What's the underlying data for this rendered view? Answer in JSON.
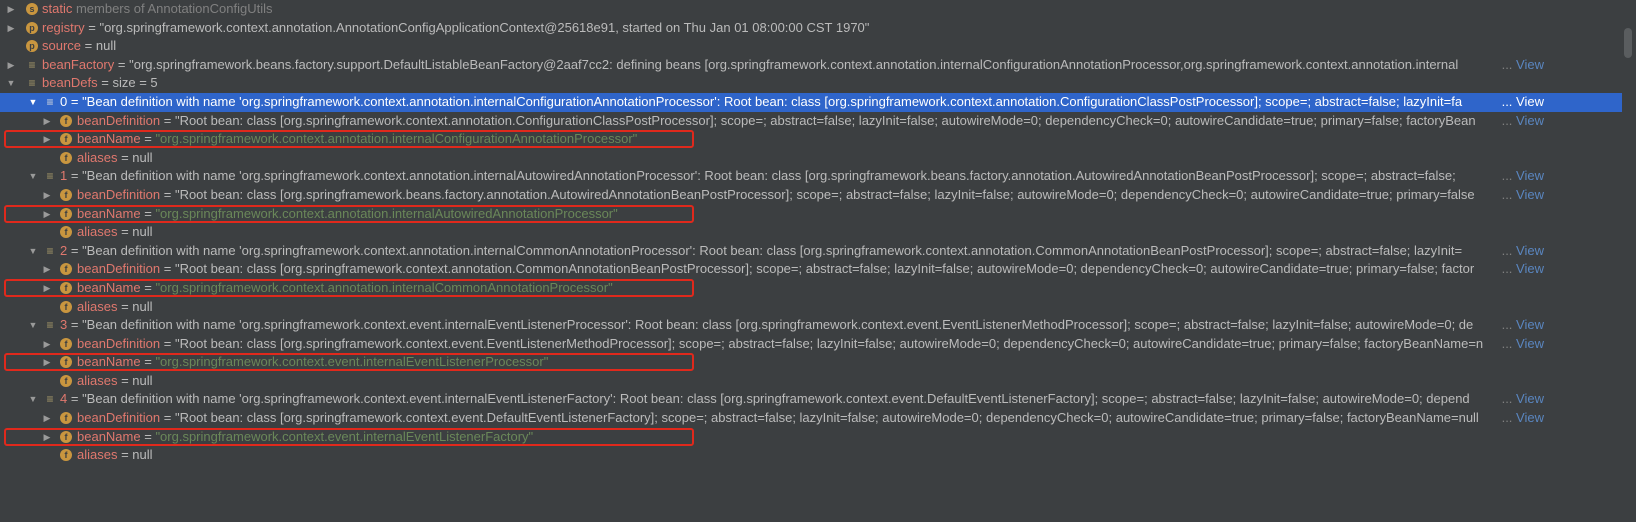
{
  "colors": {
    "background": "#3c3f41",
    "selection": "#2f65ca",
    "field_name": "#e0786e",
    "string_value": "#6a8759",
    "highlight_box": "#e0291c",
    "link": "#5a86c0"
  },
  "view_label": "View",
  "ellipsis": "...",
  "rows": [
    {
      "name": "static",
      "rest": " members of AnnotationConfigUtils",
      "icon": "s"
    },
    {
      "name": "registry",
      "eq": " = ",
      "value": "\"org.springframework.context.annotation.AnnotationConfigApplicationContext@25618e91, started on Thu Jan 01 08:00:00 CST 1970\"",
      "icon": "p"
    },
    {
      "name": "source",
      "eq": " = ",
      "value": "null",
      "icon": "p"
    },
    {
      "name": "beanFactory",
      "eq": " = ",
      "value": "\"org.springframework.beans.factory.support.DefaultListableBeanFactory@2aaf7cc2: defining beans [org.springframework.context.annotation.internalConfigurationAnnotationProcessor,org.springframework.context.annotation.internal",
      "icon": "list"
    },
    {
      "name": "beanDefs",
      "eq": " = ",
      "value": " size = 5",
      "icon": "list"
    },
    {
      "name": "0",
      "eq": " = ",
      "value": "\"Bean definition with name 'org.springframework.context.annotation.internalConfigurationAnnotationProcessor': Root bean: class [org.springframework.context.annotation.ConfigurationClassPostProcessor]; scope=; abstract=false; lazyInit=fa",
      "icon": "list"
    },
    {
      "name": "beanDefinition",
      "eq": " = ",
      "value": "\"Root bean: class [org.springframework.context.annotation.ConfigurationClassPostProcessor]; scope=; abstract=false; lazyInit=false; autowireMode=0; dependencyCheck=0; autowireCandidate=true; primary=false; factoryBean",
      "icon": "f"
    },
    {
      "name": "beanName",
      "eq": " = ",
      "value": "\"org.springframework.context.annotation.internalConfigurationAnnotationProcessor\"",
      "icon": "f"
    },
    {
      "name": "aliases",
      "eq": " = ",
      "value": "null",
      "icon": "f"
    },
    {
      "name": "1",
      "eq": " = ",
      "value": "\"Bean definition with name 'org.springframework.context.annotation.internalAutowiredAnnotationProcessor': Root bean: class [org.springframework.beans.factory.annotation.AutowiredAnnotationBeanPostProcessor]; scope=; abstract=false; ",
      "icon": "list"
    },
    {
      "name": "beanDefinition",
      "eq": " = ",
      "value": "\"Root bean: class [org.springframework.beans.factory.annotation.AutowiredAnnotationBeanPostProcessor]; scope=; abstract=false; lazyInit=false; autowireMode=0; dependencyCheck=0; autowireCandidate=true; primary=false",
      "icon": "f"
    },
    {
      "name": "beanName",
      "eq": " = ",
      "value": "\"org.springframework.context.annotation.internalAutowiredAnnotationProcessor\"",
      "icon": "f"
    },
    {
      "name": "aliases",
      "eq": " = ",
      "value": "null",
      "icon": "f"
    },
    {
      "name": "2",
      "eq": " = ",
      "value": "\"Bean definition with name 'org.springframework.context.annotation.internalCommonAnnotationProcessor': Root bean: class [org.springframework.context.annotation.CommonAnnotationBeanPostProcessor]; scope=; abstract=false; lazyInit=",
      "icon": "list"
    },
    {
      "name": "beanDefinition",
      "eq": " = ",
      "value": "\"Root bean: class [org.springframework.context.annotation.CommonAnnotationBeanPostProcessor]; scope=; abstract=false; lazyInit=false; autowireMode=0; dependencyCheck=0; autowireCandidate=true; primary=false; factor",
      "icon": "f"
    },
    {
      "name": "beanName",
      "eq": " = ",
      "value": "\"org.springframework.context.annotation.internalCommonAnnotationProcessor\"",
      "icon": "f"
    },
    {
      "name": "aliases",
      "eq": " = ",
      "value": "null",
      "icon": "f"
    },
    {
      "name": "3",
      "eq": " = ",
      "value": "\"Bean definition with name 'org.springframework.context.event.internalEventListenerProcessor': Root bean: class [org.springframework.context.event.EventListenerMethodProcessor]; scope=; abstract=false; lazyInit=false; autowireMode=0; de",
      "icon": "list"
    },
    {
      "name": "beanDefinition",
      "eq": " = ",
      "value": "\"Root bean: class [org.springframework.context.event.EventListenerMethodProcessor]; scope=; abstract=false; lazyInit=false; autowireMode=0; dependencyCheck=0; autowireCandidate=true; primary=false; factoryBeanName=n",
      "icon": "f"
    },
    {
      "name": "beanName",
      "eq": " = ",
      "value": "\"org.springframework.context.event.internalEventListenerProcessor\"",
      "icon": "f"
    },
    {
      "name": "aliases",
      "eq": " = ",
      "value": "null",
      "icon": "f"
    },
    {
      "name": "4",
      "eq": " = ",
      "value": "\"Bean definition with name 'org.springframework.context.event.internalEventListenerFactory': Root bean: class [org.springframework.context.event.DefaultEventListenerFactory]; scope=; abstract=false; lazyInit=false; autowireMode=0; depend",
      "icon": "list"
    },
    {
      "name": "beanDefinition",
      "eq": " = ",
      "value": "\"Root bean: class [org.springframework.context.event.DefaultEventListenerFactory]; scope=; abstract=false; lazyInit=false; autowireMode=0; dependencyCheck=0; autowireCandidate=true; primary=false; factoryBeanName=null",
      "icon": "f"
    },
    {
      "name": "beanName",
      "eq": " = ",
      "value": "\"org.springframework.context.event.internalEventListenerFactory\"",
      "icon": "f"
    },
    {
      "name": "aliases",
      "eq": " = ",
      "value": "null",
      "icon": "f"
    }
  ]
}
